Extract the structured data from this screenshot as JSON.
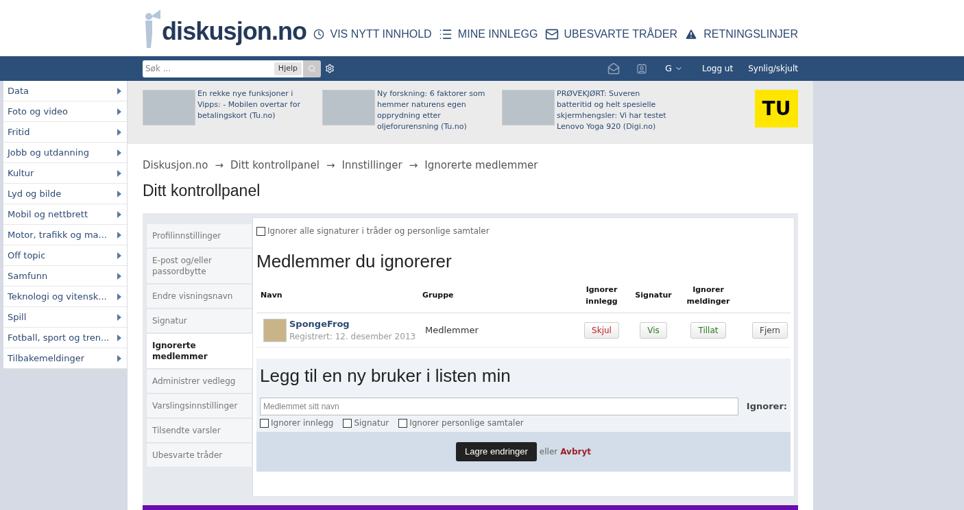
{
  "logo": {
    "text": "diskusjon.no"
  },
  "top_nav": [
    {
      "label": "VIS NYTT INNHOLD"
    },
    {
      "label": "MINE INNLEGG"
    },
    {
      "label": "UBESVARTE TRÅDER"
    },
    {
      "label": "RETNINGSLINJER"
    }
  ],
  "toolbar": {
    "search_placeholder": "Søk ...",
    "help": "Hjelp",
    "user_initial": "G",
    "logout": "Logg ut",
    "visibility": "Synlig/skjult"
  },
  "categories": [
    "Data",
    "Foto og video",
    "Fritid",
    "Jobb og utdanning",
    "Kultur",
    "Lyd og bilde",
    "Mobil og nettbrett",
    "Motor, trafikk og ma...",
    "Off topic",
    "Samfunn",
    "Teknologi og vitensk...",
    "Spill",
    "Fotball, sport og tren...",
    "Tilbakemeldinger"
  ],
  "news": [
    {
      "text": "En rekke nye funksjoner i Vipps: - Mobilen overtar for betalingskort (Tu.no)"
    },
    {
      "text": "Ny forskning: 6 faktorer som hemmer naturens egen opprydning etter oljeforurensning (Tu.no)"
    },
    {
      "text": "PRØVEKJØRT: Suveren batteritid og helt spesielle skjermhengsler: Vi har testet Lenovo Yoga 920 (Digi.no)"
    }
  ],
  "ad_logo": "TU",
  "breadcrumbs": [
    "Diskusjon.no",
    "Ditt kontrollpanel",
    "Innstillinger",
    "Ignorerte medlemmer"
  ],
  "breadcrumb_separator": "→",
  "page_title": "Ditt kontrollpanel",
  "settings_menu": [
    {
      "label": "Profilinnstillinger",
      "selected": false
    },
    {
      "label": "E-post og/eller passordbytte",
      "selected": false
    },
    {
      "label": "Endre visningsnavn",
      "selected": false
    },
    {
      "label": "Signatur",
      "selected": false
    },
    {
      "label": "Ignorerte medlemmer",
      "selected": true
    },
    {
      "label": "Administrer vedlegg",
      "selected": false
    },
    {
      "label": "Varslingsinnstillinger",
      "selected": false
    },
    {
      "label": "Tilsendte varsler",
      "selected": false
    },
    {
      "label": "Ubesvarte tråder",
      "selected": false
    }
  ],
  "ignore_all_signatures": {
    "label": "Ignorer alle signaturer i tråder og personlige samtaler",
    "checked": false
  },
  "ignored_section": {
    "title": "Medlemmer du ignorerer",
    "columns": [
      "Navn",
      "Gruppe",
      "Ignorer innlegg",
      "Signatur",
      "Ignorer meldinger"
    ],
    "rows": [
      {
        "name": "SpongeFrog",
        "registered": "Registrert: 12. desember 2013",
        "group": "Medlemmer",
        "buttons": [
          {
            "label": "Skjul",
            "kind": "danger"
          },
          {
            "label": "Vis",
            "kind": "ok"
          },
          {
            "label": "Tillat",
            "kind": "ok"
          },
          {
            "label": "Fjern",
            "kind": "neutral"
          }
        ]
      }
    ]
  },
  "add_section": {
    "title": "Legg til en ny bruker i listen min",
    "placeholder": "Medlemmet sitt navn",
    "ignore_label": "Ignorer:",
    "options": [
      {
        "label": "Ignorer innlegg",
        "checked": false
      },
      {
        "label": "Signatur",
        "checked": false
      },
      {
        "label": "Ignorer personlige samtaler",
        "checked": false
      }
    ]
  },
  "form_actions": {
    "save": "Lagre endringer",
    "or": "eller",
    "cancel": "Avbryt"
  }
}
